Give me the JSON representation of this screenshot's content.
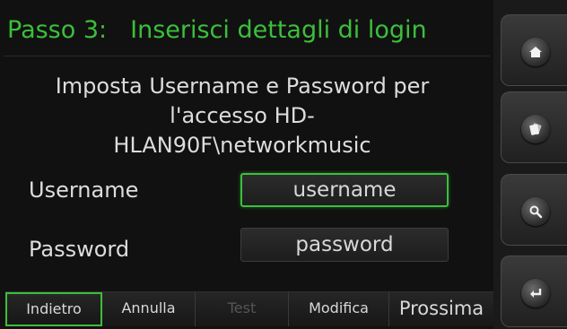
{
  "header": {
    "step": "Passo 3:",
    "title": "Inserisci dettagli di login"
  },
  "instructions": [
    "Imposta Username e Password per",
    "l'accesso HD-",
    "HLAN90F\\networkmusic"
  ],
  "form": {
    "username_label": "Username",
    "username_value": "username",
    "password_label": "Password",
    "password_value": "password"
  },
  "toolbar": {
    "back": "Indietro",
    "cancel": "Annulla",
    "test": "Test",
    "edit": "Modifica",
    "next": "Prossima"
  },
  "side_buttons": {
    "home_icon": "home-icon",
    "library_icon": "cards-icon",
    "search_icon": "magnifier-icon",
    "enter_icon": "return-arrow-icon"
  },
  "colors": {
    "accent": "#3cbf3c",
    "background": "#111111",
    "text": "#d8d8d8",
    "disabled": "#555555"
  }
}
